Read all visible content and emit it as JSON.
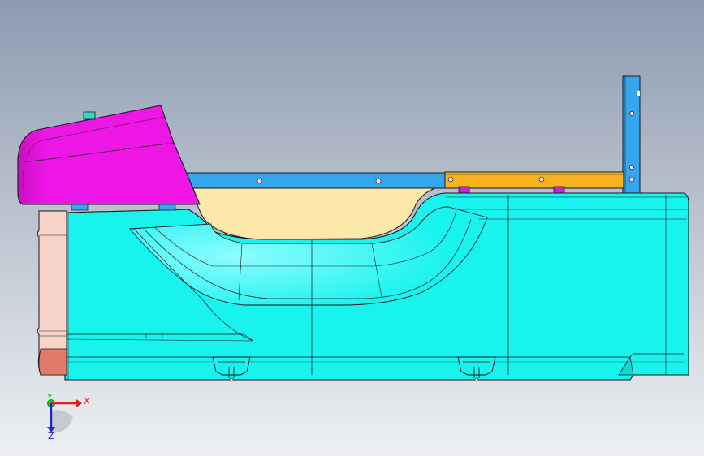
{
  "viewport": {
    "background_top": "#8d9bb0",
    "background_bottom": "#eef0f3"
  },
  "model": {
    "colors": {
      "body": "#19f3ee",
      "body_dark": "#12d6d2",
      "seat_pad": "#fce8a9",
      "head_cushion": "#ee16e5",
      "head_cushion_dark": "#c80ec1",
      "rail": "#35a6ee",
      "rail_extension": "#f8b21d",
      "bracket": "#c322e2",
      "end_panel": "#f8d3c9",
      "end_panel_dark": "#e07a6a",
      "post": "#35a6ee",
      "edge": "#1a1a1a"
    }
  },
  "triad": {
    "x_label": "X",
    "y_label": "Y",
    "z_label": "Z",
    "x_color": "#e01e1e",
    "y_color": "#19c21b",
    "z_color": "#2424c8"
  }
}
